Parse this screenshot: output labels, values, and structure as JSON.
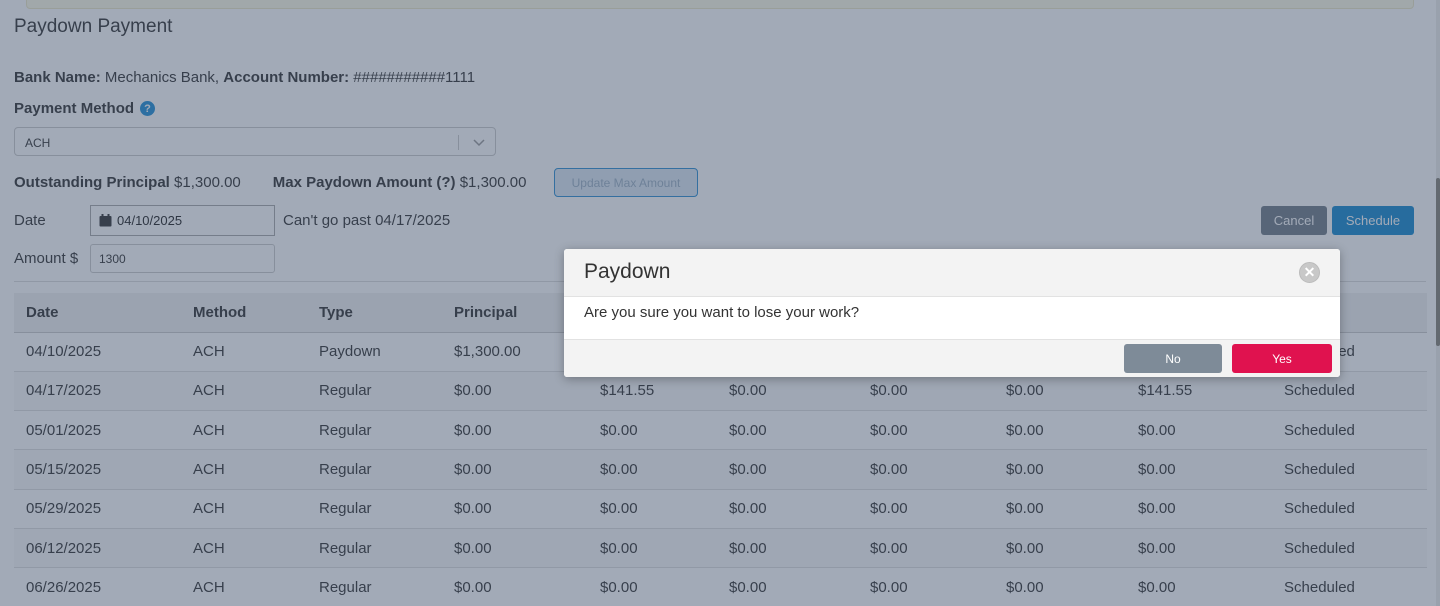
{
  "page": {
    "title": "Paydown Payment"
  },
  "bank": {
    "name_label": "Bank Name:",
    "name_value": "Mechanics Bank,",
    "account_label": "Account Number:",
    "account_value": "###########1111"
  },
  "payment_method": {
    "label": "Payment Method",
    "help_glyph": "?",
    "selected": "ACH"
  },
  "principal": {
    "outstanding_label": "Outstanding Principal",
    "outstanding_value": "$1,300.00",
    "max_label": "Max Paydown Amount (?)",
    "max_value": "$1,300.00",
    "update_button": "Update Max Amount"
  },
  "date": {
    "label": "Date",
    "value": "04/10/2025",
    "limit_text": "Can't go past 04/17/2025"
  },
  "actions": {
    "cancel": "Cancel",
    "schedule": "Schedule"
  },
  "amount": {
    "label": "Amount $",
    "value": "1300"
  },
  "table": {
    "headers": [
      "Date",
      "Method",
      "Type",
      "Principal",
      "",
      "",
      "",
      "",
      "",
      ""
    ],
    "rows": [
      [
        "04/10/2025",
        "ACH",
        "Paydown",
        "$1,300.00",
        "",
        "",
        "",
        "",
        "",
        "Scheduled"
      ],
      [
        "04/17/2025",
        "ACH",
        "Regular",
        "$0.00",
        "$141.55",
        "$0.00",
        "$0.00",
        "$0.00",
        "$141.55",
        "Scheduled"
      ],
      [
        "05/01/2025",
        "ACH",
        "Regular",
        "$0.00",
        "$0.00",
        "$0.00",
        "$0.00",
        "$0.00",
        "$0.00",
        "Scheduled"
      ],
      [
        "05/15/2025",
        "ACH",
        "Regular",
        "$0.00",
        "$0.00",
        "$0.00",
        "$0.00",
        "$0.00",
        "$0.00",
        "Scheduled"
      ],
      [
        "05/29/2025",
        "ACH",
        "Regular",
        "$0.00",
        "$0.00",
        "$0.00",
        "$0.00",
        "$0.00",
        "$0.00",
        "Scheduled"
      ],
      [
        "06/12/2025",
        "ACH",
        "Regular",
        "$0.00",
        "$0.00",
        "$0.00",
        "$0.00",
        "$0.00",
        "$0.00",
        "Scheduled"
      ],
      [
        "06/26/2025",
        "ACH",
        "Regular",
        "$0.00",
        "$0.00",
        "$0.00",
        "$0.00",
        "$0.00",
        "$0.00",
        "Scheduled"
      ]
    ]
  },
  "modal": {
    "title": "Paydown",
    "close_glyph": "✕",
    "message": "Are you sure you want to lose your work?",
    "no_label": "No",
    "yes_label": "Yes"
  },
  "colors": {
    "overlay": "#3c4e68",
    "primary": "#1589d0",
    "danger": "#e0124f",
    "neutral": "#7e8b98"
  }
}
